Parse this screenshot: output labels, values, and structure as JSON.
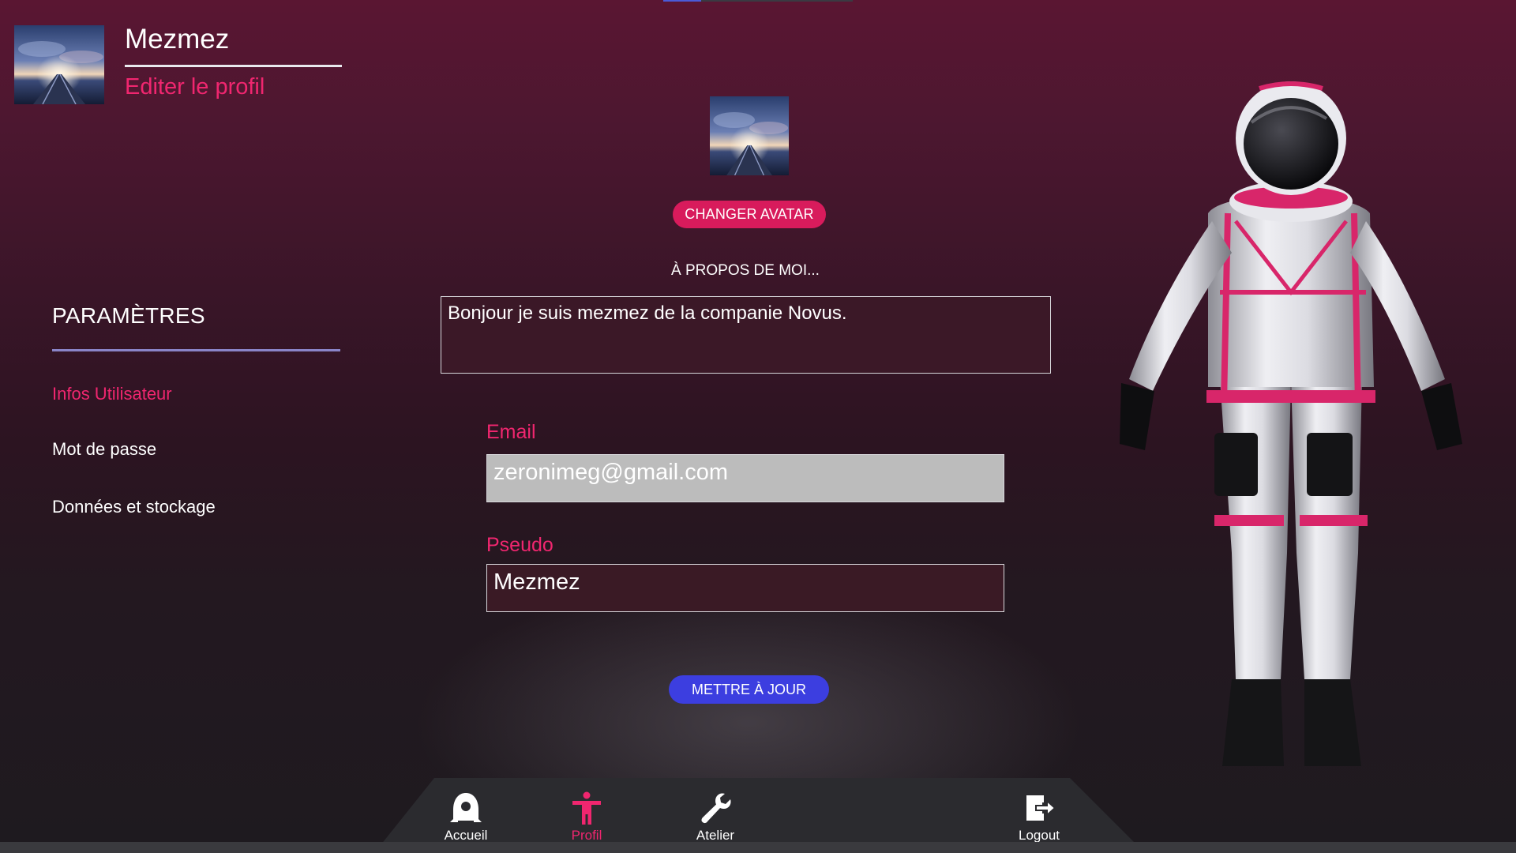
{
  "header": {
    "username": "Mezmez",
    "edit_link": "Editer le profil"
  },
  "sidebar": {
    "title": "PARAMÈTRES",
    "items": [
      {
        "label": "Infos Utilisateur",
        "active": true
      },
      {
        "label": "Mot de passe",
        "active": false
      },
      {
        "label": "Données et stockage",
        "active": false
      }
    ]
  },
  "profile": {
    "change_avatar_label": "CHANGER AVATAR",
    "about_label": "À PROPOS DE MOI...",
    "about_text": "Bonjour je suis mezmez de la companie Novus.",
    "email_label": "Email",
    "email_value": "zeronimeg@gmail.com",
    "pseudo_label": "Pseudo",
    "pseudo_value": "Mezmez",
    "update_label": "METTRE À JOUR"
  },
  "nav": {
    "items": [
      {
        "label": "Accueil",
        "icon": "rocket-icon",
        "active": false
      },
      {
        "label": "Profil",
        "icon": "person-icon",
        "active": true
      },
      {
        "label": "Atelier",
        "icon": "wrench-icon",
        "active": false
      },
      {
        "label": "Logout",
        "icon": "logout-icon",
        "active": false
      }
    ]
  },
  "colors": {
    "accent_pink": "#f0266f",
    "button_pink": "#d81b5c",
    "button_blue": "#3c3ee0",
    "divider_lavender": "#8a84c8"
  }
}
